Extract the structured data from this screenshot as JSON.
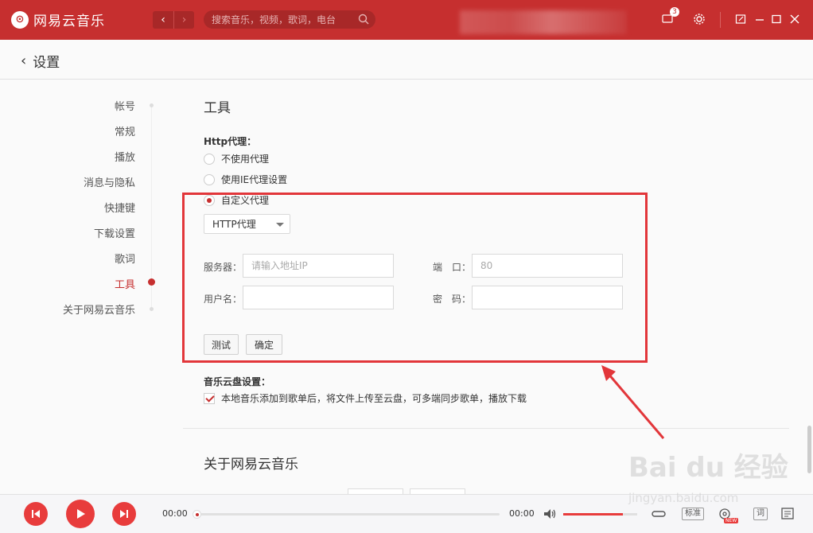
{
  "app": {
    "name": "网易云音乐",
    "logo_icon": "netease-logo-icon"
  },
  "search": {
    "placeholder": "搜索音乐，视频，歌词，电台"
  },
  "titlebar": {
    "notification_count": "3"
  },
  "header": {
    "title": "设置"
  },
  "sidebar": {
    "items": [
      {
        "label": "帐号"
      },
      {
        "label": "常规"
      },
      {
        "label": "播放"
      },
      {
        "label": "消息与隐私"
      },
      {
        "label": "快捷键"
      },
      {
        "label": "下载设置"
      },
      {
        "label": "歌词"
      },
      {
        "label": "工具",
        "active": true
      },
      {
        "label": "关于网易云音乐"
      }
    ]
  },
  "tools": {
    "title": "工具",
    "proxy_label": "Http代理：",
    "radio_options": [
      {
        "label": "不使用代理",
        "checked": false
      },
      {
        "label": "使用IE代理设置",
        "checked": false
      },
      {
        "label": "自定义代理",
        "checked": true
      }
    ],
    "proxy_type": "HTTP代理",
    "server_label": "服务器：",
    "server_placeholder": "请输入地址IP",
    "port_label": "端　口：",
    "port_placeholder": "80",
    "username_label": "用户名：",
    "password_label": "密　码：",
    "test_button": "测试",
    "confirm_button": "确定",
    "cloud_label": "音乐云盘设置：",
    "cloud_option": "本地音乐添加到歌单后，将文件上传至云盘，可多端同步歌单，播放下载",
    "cloud_checked": true
  },
  "about": {
    "title": "关于网易云音乐"
  },
  "player": {
    "current_time": "00:00",
    "total_time": "00:00",
    "volume_level": 0.81,
    "quality_label": "标准",
    "lyrics_label": "词",
    "new_badge": "NEW"
  },
  "watermark": {
    "main": "Bai du 经验",
    "sub": "jingyan.baidu.com"
  },
  "colors": {
    "brand": "#c62f2f",
    "highlight": "#e2363a",
    "accent": "#e83c3c"
  }
}
